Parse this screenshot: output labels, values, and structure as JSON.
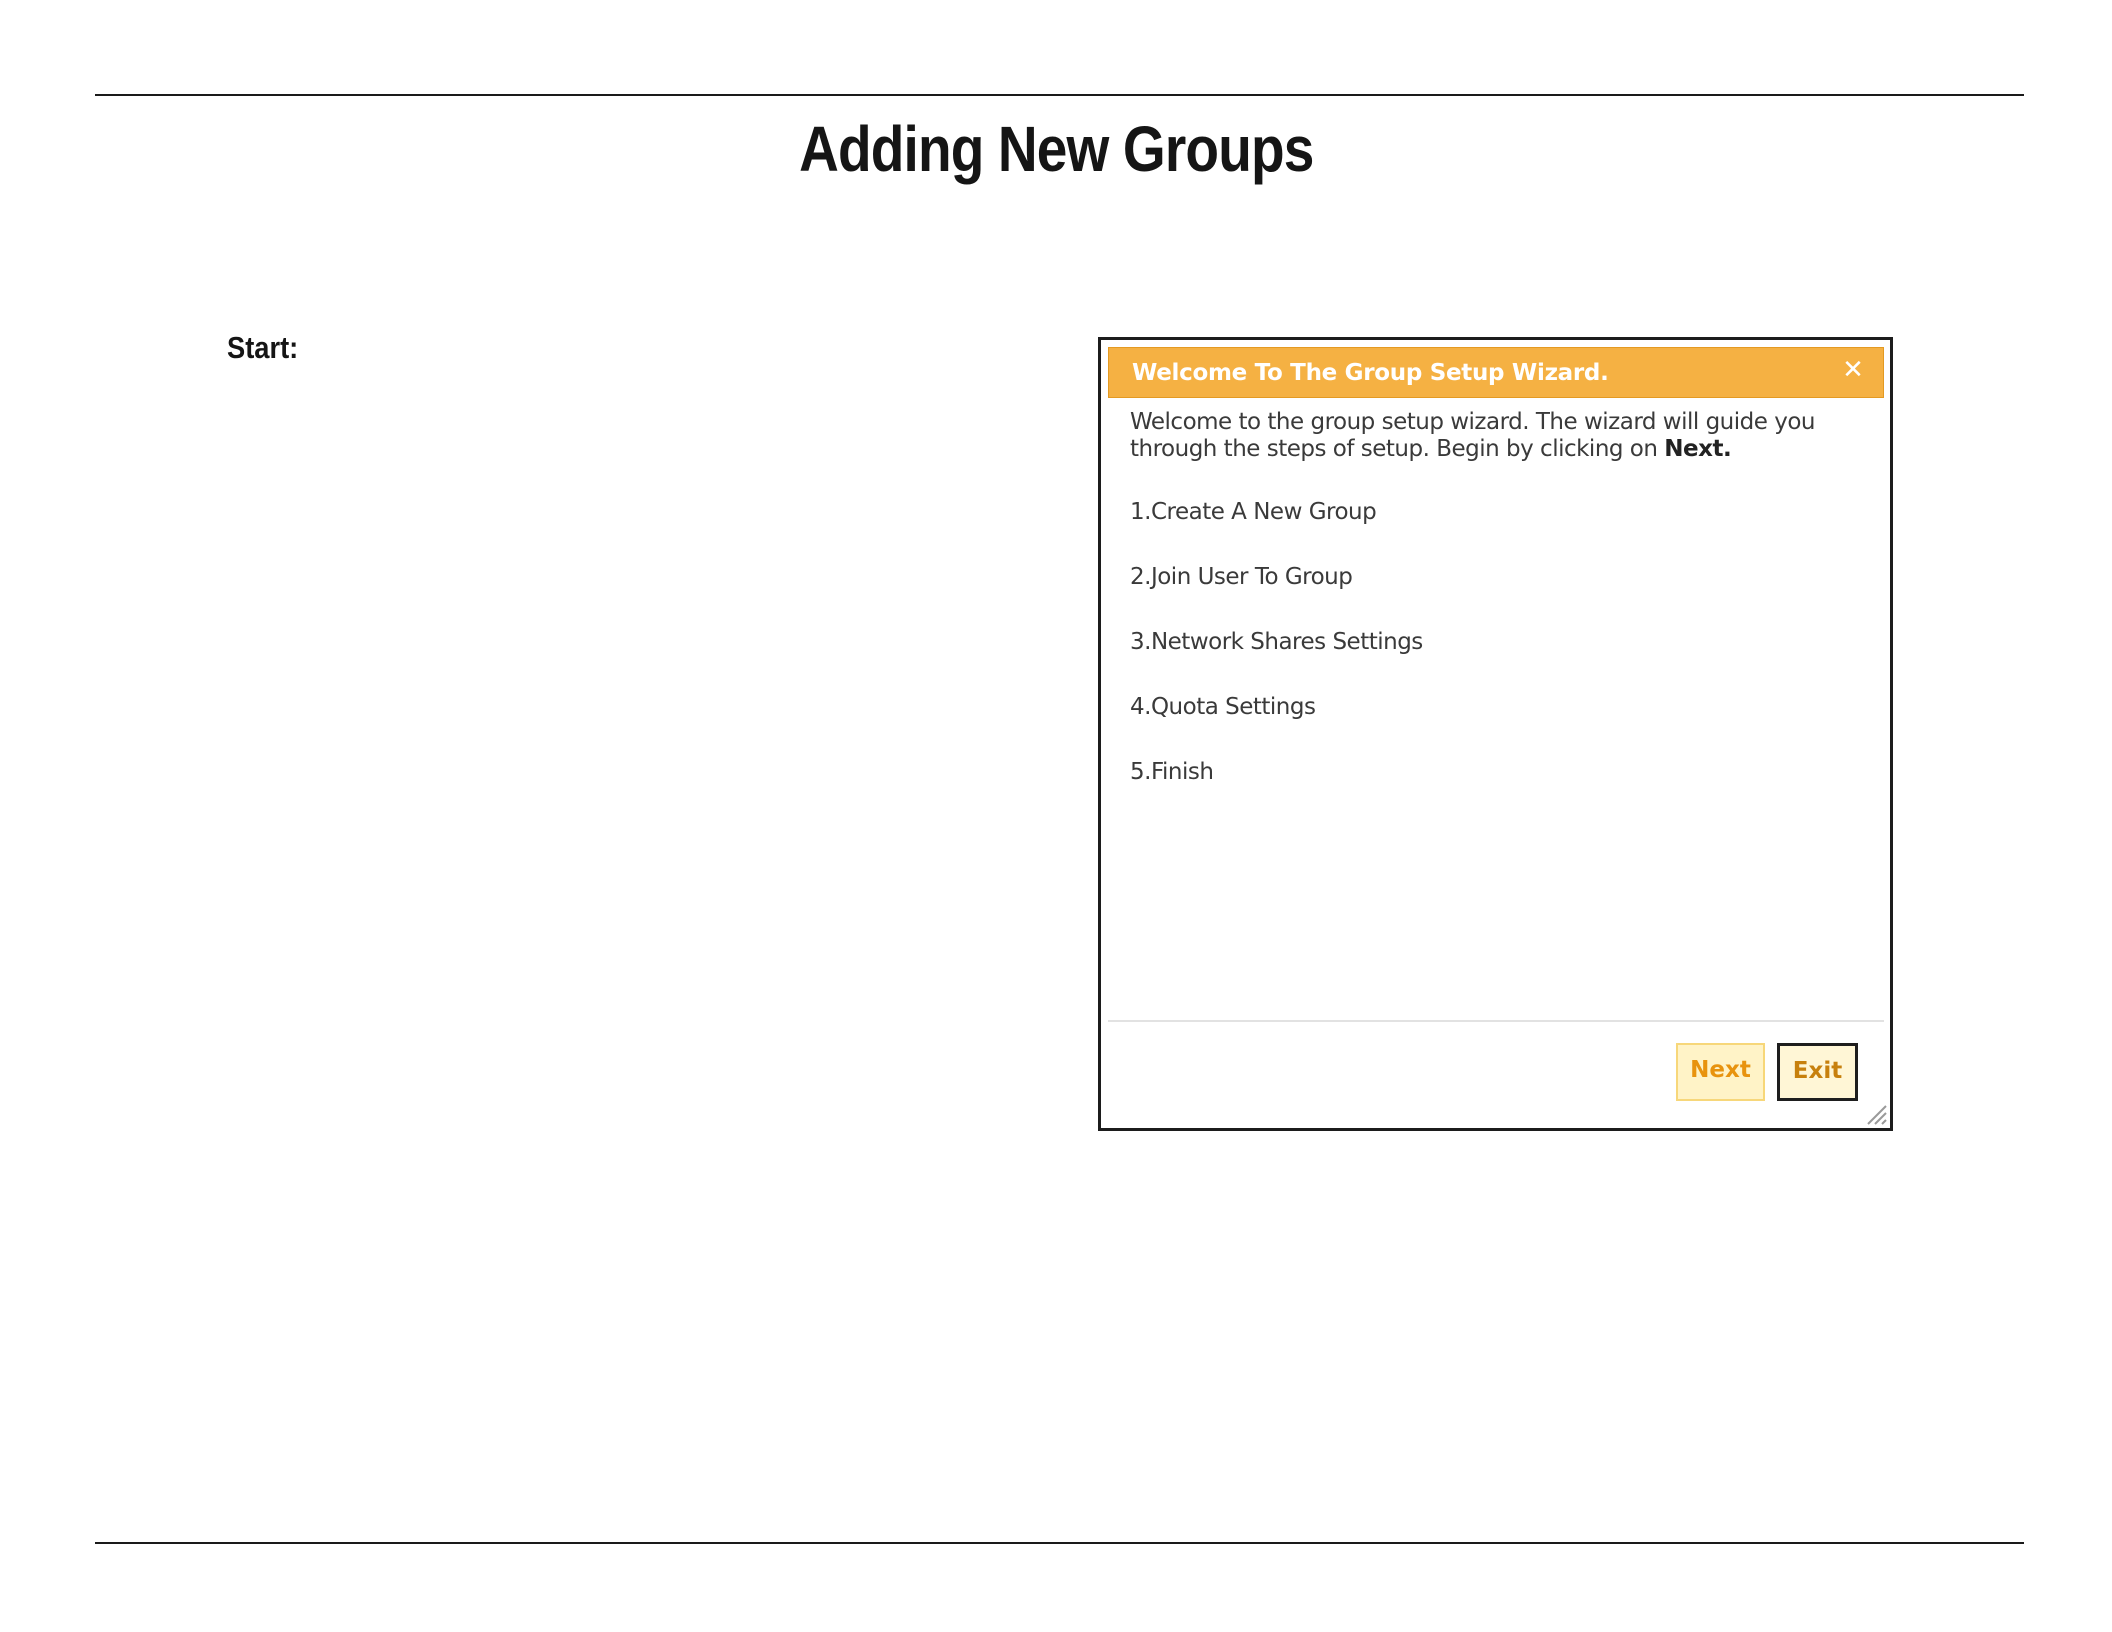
{
  "document": {
    "title": "Adding New Groups",
    "step_label": "Start:"
  },
  "wizard": {
    "title": "Welcome To The Group Setup Wizard.",
    "close_icon": "close-icon",
    "intro_text": "Welcome to the group setup wizard. The wizard will guide you through the steps of setup. Begin by clicking on ",
    "intro_bold": "Next",
    "intro_end": ".",
    "steps": [
      "1.Create A New Group",
      "2.Join User To Group",
      "3.Network Shares Settings",
      "4.Quota Settings",
      "5.Finish"
    ],
    "buttons": {
      "next_label": "Next",
      "exit_label": "Exit"
    },
    "colors": {
      "header": "#f5b143",
      "button_text": "#e8930e"
    }
  }
}
